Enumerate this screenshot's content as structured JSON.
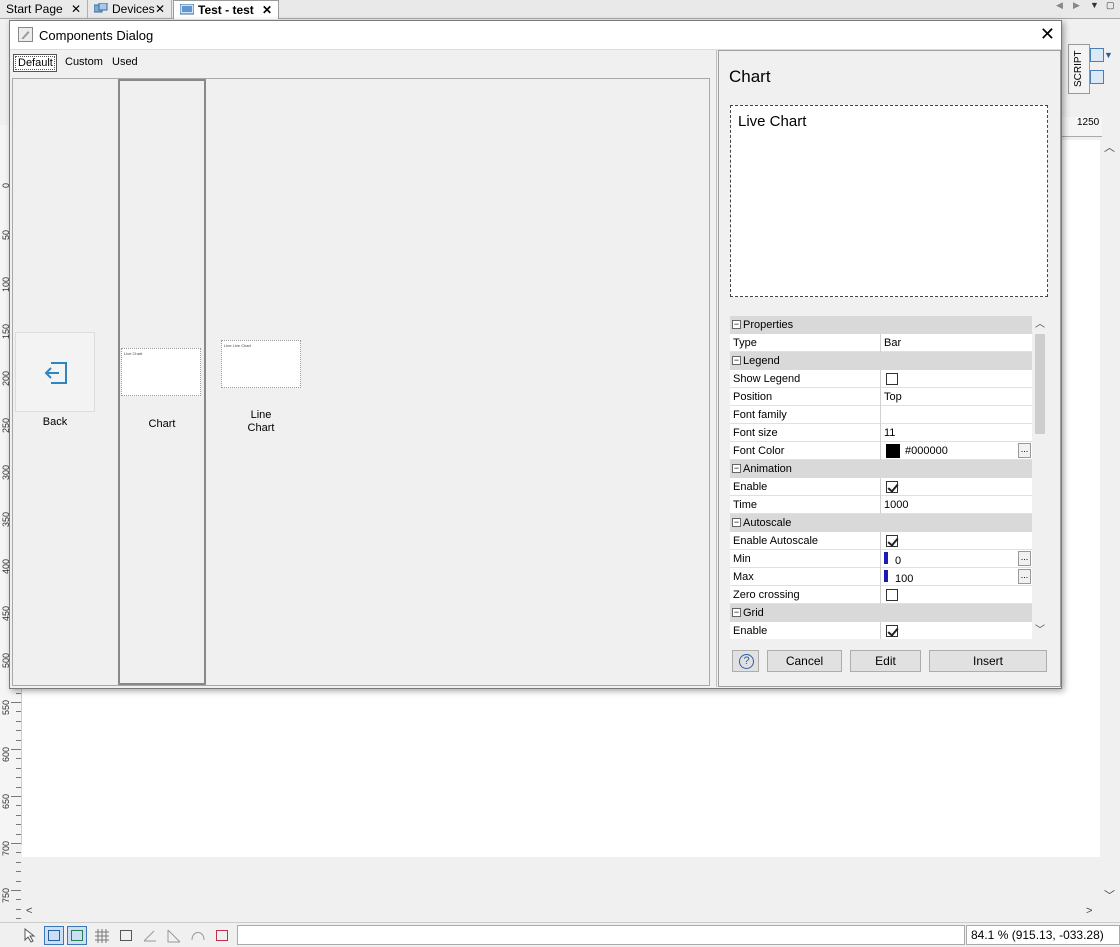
{
  "tabs": [
    {
      "label": "Start Page",
      "active": false
    },
    {
      "label": "Devices",
      "active": false
    },
    {
      "label": "Test - test",
      "active": true
    }
  ],
  "ruler_left_labels": [
    "0",
    "50",
    "100",
    "150",
    "200",
    "250",
    "300",
    "350",
    "400",
    "450",
    "500",
    "550",
    "600",
    "650",
    "700",
    "750"
  ],
  "ruler_top_label": "1250",
  "script_panel_label": "SCRIPT",
  "status": {
    "zoom": "84.1 %",
    "coords": "(915.13, -033.28)"
  },
  "dialog": {
    "title": "Components Dialog",
    "tabs": [
      {
        "label": "Default",
        "active": true
      },
      {
        "label": "Custom",
        "active": false
      },
      {
        "label": "Used",
        "active": false
      }
    ],
    "components": [
      {
        "label": "Back",
        "thumb": ""
      },
      {
        "label": "Chart",
        "thumb": "Live Chart"
      },
      {
        "label": "Line Chart",
        "thumb": "Line Live Chart"
      }
    ],
    "side_title": "Chart",
    "preview_text": "Live Chart",
    "props": [
      {
        "kind": "section",
        "name": "Properties"
      },
      {
        "kind": "row",
        "name": "Type",
        "value": "Bar"
      },
      {
        "kind": "section",
        "name": "Legend"
      },
      {
        "kind": "row",
        "name": "Show Legend",
        "check": false
      },
      {
        "kind": "row",
        "name": "Position",
        "value": "Top"
      },
      {
        "kind": "row",
        "name": "Font family",
        "value": ""
      },
      {
        "kind": "row",
        "name": "Font size",
        "value": "11"
      },
      {
        "kind": "row",
        "name": "Font Color",
        "color": "#000000",
        "value": "#000000"
      },
      {
        "kind": "section",
        "name": "Animation"
      },
      {
        "kind": "row",
        "name": "Enable",
        "check": true
      },
      {
        "kind": "row",
        "name": "Time",
        "value": "1000"
      },
      {
        "kind": "section",
        "name": "Autoscale"
      },
      {
        "kind": "row",
        "name": "Enable Autoscale",
        "check": true
      },
      {
        "kind": "row",
        "name": "Min",
        "num": "0"
      },
      {
        "kind": "row",
        "name": "Max",
        "num": "100"
      },
      {
        "kind": "row",
        "name": "Zero crossing",
        "check": false
      },
      {
        "kind": "section",
        "name": "Grid"
      },
      {
        "kind": "row",
        "name": "Enable",
        "check": true
      }
    ],
    "buttons": {
      "help": "?",
      "cancel": "Cancel",
      "edit": "Edit",
      "insert": "Insert"
    }
  }
}
